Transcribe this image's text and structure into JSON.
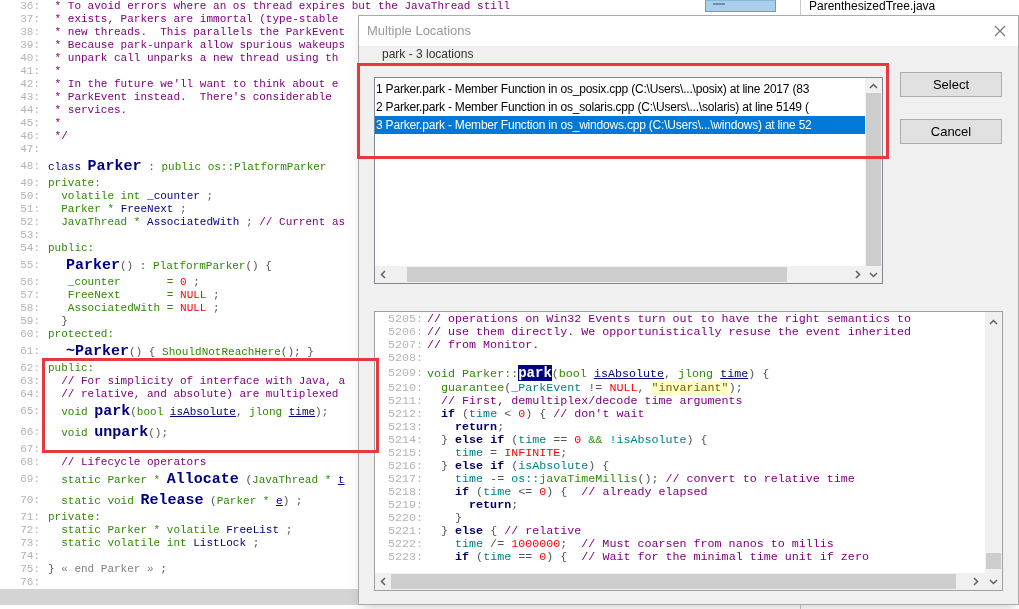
{
  "editor": {
    "lines": [
      {
        "number": "36:",
        "segments": [
          {
            "kind": "c",
            "text": " * To avoid errors where an os thread expires but the JavaThread still"
          }
        ]
      },
      {
        "number": "37:",
        "segments": [
          {
            "kind": "c",
            "text": " * exists, Parkers are immortal (type-stable"
          }
        ]
      },
      {
        "number": "38:",
        "segments": [
          {
            "kind": "c",
            "text": " * new threads.  This parallels the ParkEvent"
          }
        ]
      },
      {
        "number": "39:",
        "segments": [
          {
            "kind": "c",
            "text": " * Because park-unpark allow spurious wakeups"
          }
        ]
      },
      {
        "number": "40:",
        "segments": [
          {
            "kind": "c",
            "text": " * unpark call unparks a new thread using th"
          }
        ]
      },
      {
        "number": "41:",
        "segments": [
          {
            "kind": "c",
            "text": " *"
          }
        ]
      },
      {
        "number": "42:",
        "segments": [
          {
            "kind": "c",
            "text": " * In the future we'll want to think about e"
          }
        ]
      },
      {
        "number": "43:",
        "segments": [
          {
            "kind": "c",
            "text": " * ParkEvent instead.  There's considerable"
          }
        ]
      },
      {
        "number": "44:",
        "segments": [
          {
            "kind": "c",
            "text": " * services."
          }
        ]
      },
      {
        "number": "45:",
        "segments": [
          {
            "kind": "c",
            "text": " *"
          }
        ]
      },
      {
        "number": "46:",
        "segments": [
          {
            "kind": "c",
            "text": " */"
          }
        ]
      },
      {
        "number": "47:"
      },
      {
        "number": "48:",
        "segments": [
          {
            "kind": "id",
            "text": "class "
          },
          {
            "kind": "fn",
            "text": "Parker"
          },
          {
            "kind": "kw",
            "text": " : public os::PlatformParker"
          }
        ]
      },
      {
        "number": "49:",
        "segments": [
          {
            "kind": "kw",
            "text": "private:"
          }
        ]
      },
      {
        "number": "50:",
        "segments": [
          {
            "kind": "kw",
            "text": "  volatile int "
          },
          {
            "kind": "id",
            "text": "_counter"
          },
          {
            "kind": "p",
            "text": " ;"
          }
        ]
      },
      {
        "number": "51:",
        "segments": [
          {
            "kind": "kw",
            "text": "  Parker * "
          },
          {
            "kind": "id",
            "text": "FreeNext"
          },
          {
            "kind": "p",
            "text": " ;"
          }
        ]
      },
      {
        "number": "52:",
        "segments": [
          {
            "kind": "kw",
            "text": "  JavaThread * "
          },
          {
            "kind": "id",
            "text": "AssociatedWith"
          },
          {
            "kind": "p",
            "text": " ; "
          },
          {
            "kind": "c",
            "text": "// Current as"
          }
        ]
      },
      {
        "number": "53:"
      },
      {
        "number": "54:",
        "segments": [
          {
            "kind": "kw",
            "text": "public:"
          }
        ]
      },
      {
        "number": "55:",
        "segments": [
          {
            "kind": "fn",
            "text": "  Parker"
          },
          {
            "kind": "p",
            "text": "() : "
          },
          {
            "kind": "kw",
            "text": "PlatformParker"
          },
          {
            "kind": "p",
            "text": "() {"
          }
        ]
      },
      {
        "number": "56:",
        "segments": [
          {
            "kind": "kw",
            "text": "   _counter       = "
          },
          {
            "kind": "num",
            "text": "0"
          },
          {
            "kind": "p",
            "text": " ;"
          }
        ]
      },
      {
        "number": "57:",
        "segments": [
          {
            "kind": "kw",
            "text": "   FreeNext       = "
          },
          {
            "kind": "num",
            "text": "NULL"
          },
          {
            "kind": "p",
            "text": " ;"
          }
        ]
      },
      {
        "number": "58:",
        "segments": [
          {
            "kind": "kw",
            "text": "   AssociatedWith = "
          },
          {
            "kind": "num",
            "text": "NULL"
          },
          {
            "kind": "p",
            "text": " ;"
          }
        ]
      },
      {
        "number": "59:",
        "segments": [
          {
            "kind": "p",
            "text": "  }"
          }
        ]
      },
      {
        "number": "60:",
        "segments": [
          {
            "kind": "kw",
            "text": "protected:"
          }
        ]
      },
      {
        "number": "61:",
        "segments": [
          {
            "kind": "fn",
            "text": "  ~Parker"
          },
          {
            "kind": "p",
            "text": "() { "
          },
          {
            "kind": "kw",
            "text": "ShouldNotReachHere"
          },
          {
            "kind": "p",
            "text": "(); }"
          }
        ]
      },
      {
        "number": "62:",
        "segments": [
          {
            "kind": "kw",
            "text": "public:"
          }
        ]
      },
      {
        "number": "63:",
        "segments": [
          {
            "kind": "c",
            "text": "  // For simplicity of interface with Java, a"
          }
        ]
      },
      {
        "number": "64:",
        "segments": [
          {
            "kind": "c",
            "text": "  // relative, and absolute) are multiplexed"
          }
        ]
      },
      {
        "number": "65:",
        "segments": [
          {
            "kind": "kw",
            "text": "  void "
          },
          {
            "kind": "fn",
            "text": "park"
          },
          {
            "kind": "p",
            "text": "("
          },
          {
            "kind": "kw",
            "text": "bool "
          },
          {
            "kind": "param",
            "text": "isAbsolute"
          },
          {
            "kind": "p",
            "text": ", "
          },
          {
            "kind": "kw",
            "text": "jlong "
          },
          {
            "kind": "param",
            "text": "time"
          },
          {
            "kind": "p",
            "text": ");"
          }
        ]
      },
      {
        "number": "66:",
        "segments": [
          {
            "kind": "kw",
            "text": "  void "
          },
          {
            "kind": "fn",
            "text": "unpark"
          },
          {
            "kind": "p",
            "text": "();"
          }
        ]
      },
      {
        "number": "67:"
      },
      {
        "number": "68:",
        "segments": [
          {
            "kind": "c",
            "text": "  // Lifecycle operators"
          }
        ]
      },
      {
        "number": "69:",
        "segments": [
          {
            "kind": "kw",
            "text": "  static Parker * "
          },
          {
            "kind": "fn",
            "text": "Allocate"
          },
          {
            "kind": "p",
            "text": " ("
          },
          {
            "kind": "kw",
            "text": "JavaThread * "
          },
          {
            "kind": "param",
            "text": "t"
          }
        ]
      },
      {
        "number": "70:",
        "segments": [
          {
            "kind": "kw",
            "text": "  static void "
          },
          {
            "kind": "fn",
            "text": "Release"
          },
          {
            "kind": "p",
            "text": " ("
          },
          {
            "kind": "kw",
            "text": "Parker * "
          },
          {
            "kind": "param",
            "text": "e"
          },
          {
            "kind": "p",
            "text": ") ;"
          }
        ]
      },
      {
        "number": "71:",
        "segments": [
          {
            "kind": "kw",
            "text": "private:"
          }
        ]
      },
      {
        "number": "72:",
        "segments": [
          {
            "kind": "kw",
            "text": "  static Parker * volatile "
          },
          {
            "kind": "id",
            "text": "FreeList"
          },
          {
            "kind": "p",
            "text": " ;"
          }
        ]
      },
      {
        "number": "73:",
        "segments": [
          {
            "kind": "kw",
            "text": "  static volatile int "
          },
          {
            "kind": "id",
            "text": "ListLock"
          },
          {
            "kind": "p",
            "text": " ;"
          }
        ]
      },
      {
        "number": "74:"
      },
      {
        "number": "75:",
        "segments": [
          {
            "kind": "p",
            "text": "} "
          },
          {
            "kind": "mark",
            "text": "« end Parker »"
          },
          {
            "kind": "p",
            "text": " ;"
          }
        ]
      },
      {
        "number": "76:"
      }
    ]
  },
  "file_panel": {
    "file_name": "ParenthesizedTree.java"
  },
  "dialog": {
    "title": "Multiple Locations",
    "label": "park - 3 locations",
    "locations": [
      {
        "text": "1 Parker.park - Member Function in os_posix.cpp (C:\\Users\\...\\posix) at line 2017 (83",
        "selected": false
      },
      {
        "text": "2 Parker.park - Member Function in os_solaris.cpp (C:\\Users\\...\\solaris) at line 5149 (",
        "selected": false
      },
      {
        "text": "3 Parker.park - Member Function in os_windows.cpp (C:\\Users\\...\\windows) at line 52",
        "selected": true
      }
    ],
    "buttons": [
      "Select",
      "Cancel"
    ],
    "preview": {
      "lines": [
        {
          "number": "5205:",
          "segments": [
            {
              "kind": "c",
              "text": "// operations on Win32 Events turn out to have the right semantics to"
            }
          ]
        },
        {
          "number": "5206:",
          "segments": [
            {
              "kind": "c",
              "text": "// use them directly. We opportunistically resuse the event inherited"
            }
          ]
        },
        {
          "number": "5207:",
          "segments": [
            {
              "kind": "c",
              "text": "// from Monitor."
            }
          ]
        },
        {
          "number": "5208:"
        },
        {
          "number": "5209:",
          "segments": [
            {
              "kind": "kw",
              "text": "void Parker::"
            },
            {
              "kind": "hl",
              "text": "park"
            },
            {
              "kind": "p",
              "text": "("
            },
            {
              "kind": "kw",
              "text": "bool "
            },
            {
              "kind": "param",
              "text": "isAbsolute"
            },
            {
              "kind": "p",
              "text": ", "
            },
            {
              "kind": "kw",
              "text": "jlong "
            },
            {
              "kind": "param",
              "text": "time"
            },
            {
              "kind": "p",
              "text": ") {"
            }
          ]
        },
        {
          "number": "5210:",
          "segments": [
            {
              "kind": "kw",
              "text": "  guarantee"
            },
            {
              "kind": "p",
              "text": "("
            },
            {
              "kind": "var",
              "text": "_ParkEvent"
            },
            {
              "kind": "p",
              "text": " != "
            },
            {
              "kind": "num",
              "text": "NULL"
            },
            {
              "kind": "p",
              "text": ", "
            },
            {
              "kind": "str",
              "text": "\"invariant\""
            },
            {
              "kind": "p",
              "text": ");"
            }
          ]
        },
        {
          "number": "5211:",
          "segments": [
            {
              "kind": "c",
              "text": "  // First, demultiplex/decode time arguments"
            }
          ]
        },
        {
          "number": "5212:",
          "segments": [
            {
              "kind": "ctl",
              "text": "  if "
            },
            {
              "kind": "p",
              "text": "("
            },
            {
              "kind": "var",
              "text": "time"
            },
            {
              "kind": "p",
              "text": " < "
            },
            {
              "kind": "num",
              "text": "0"
            },
            {
              "kind": "p",
              "text": ") { "
            },
            {
              "kind": "c",
              "text": "// don't wait"
            }
          ]
        },
        {
          "number": "5213:",
          "segments": [
            {
              "kind": "ctl",
              "text": "    return"
            },
            {
              "kind": "p",
              "text": ";"
            }
          ]
        },
        {
          "number": "5214:",
          "segments": [
            {
              "kind": "p",
              "text": "  } "
            },
            {
              "kind": "ctl",
              "text": "else if "
            },
            {
              "kind": "p",
              "text": "("
            },
            {
              "kind": "var",
              "text": "time"
            },
            {
              "kind": "p",
              "text": " == "
            },
            {
              "kind": "num",
              "text": "0"
            },
            {
              "kind": "kw",
              "text": " && "
            },
            {
              "kind": "var",
              "text": "!isAbsolute"
            },
            {
              "kind": "p",
              "text": ") {"
            }
          ]
        },
        {
          "number": "5215:",
          "segments": [
            {
              "kind": "var",
              "text": "    time"
            },
            {
              "kind": "p",
              "text": " = "
            },
            {
              "kind": "num",
              "text": "INFINITE"
            },
            {
              "kind": "p",
              "text": ";"
            }
          ]
        },
        {
          "number": "5216:",
          "segments": [
            {
              "kind": "p",
              "text": "  } "
            },
            {
              "kind": "ctl",
              "text": "else if "
            },
            {
              "kind": "p",
              "text": "("
            },
            {
              "kind": "var",
              "text": "isAbsolute"
            },
            {
              "kind": "p",
              "text": ") {"
            }
          ]
        },
        {
          "number": "5217:",
          "segments": [
            {
              "kind": "var",
              "text": "    time"
            },
            {
              "kind": "p",
              "text": " -= "
            },
            {
              "kind": "var",
              "text": "os::"
            },
            {
              "kind": "kw",
              "text": "javaTimeMillis"
            },
            {
              "kind": "p",
              "text": "(); "
            },
            {
              "kind": "c",
              "text": "// convert to relative time"
            }
          ]
        },
        {
          "number": "5218:",
          "segments": [
            {
              "kind": "ctl",
              "text": "    if "
            },
            {
              "kind": "p",
              "text": "("
            },
            {
              "kind": "var",
              "text": "time"
            },
            {
              "kind": "p",
              "text": " <= "
            },
            {
              "kind": "num",
              "text": "0"
            },
            {
              "kind": "p",
              "text": ") {  "
            },
            {
              "kind": "c",
              "text": "// already elapsed"
            }
          ]
        },
        {
          "number": "5219:",
          "segments": [
            {
              "kind": "ctl",
              "text": "      return"
            },
            {
              "kind": "p",
              "text": ";"
            }
          ]
        },
        {
          "number": "5220:",
          "segments": [
            {
              "kind": "p",
              "text": "    }"
            }
          ]
        },
        {
          "number": "5221:",
          "segments": [
            {
              "kind": "p",
              "text": "  } "
            },
            {
              "kind": "ctl",
              "text": "else"
            },
            {
              "kind": "p",
              "text": " { "
            },
            {
              "kind": "c",
              "text": "// relative"
            }
          ]
        },
        {
          "number": "5222:",
          "segments": [
            {
              "kind": "var",
              "text": "    time"
            },
            {
              "kind": "p",
              "text": " /= "
            },
            {
              "kind": "num",
              "text": "1000000"
            },
            {
              "kind": "p",
              "text": ";  "
            },
            {
              "kind": "c",
              "text": "// Must coarsen from nanos to millis"
            }
          ]
        },
        {
          "number": "5223:",
          "segments": [
            {
              "kind": "ctl",
              "text": "    if "
            },
            {
              "kind": "p",
              "text": "("
            },
            {
              "kind": "var",
              "text": "time"
            },
            {
              "kind": "p",
              "text": " == "
            },
            {
              "kind": "num",
              "text": "0"
            },
            {
              "kind": "p",
              "text": ") {  "
            },
            {
              "kind": "c",
              "text": "// Wait for the minimal time unit if zero"
            }
          ]
        }
      ]
    }
  }
}
